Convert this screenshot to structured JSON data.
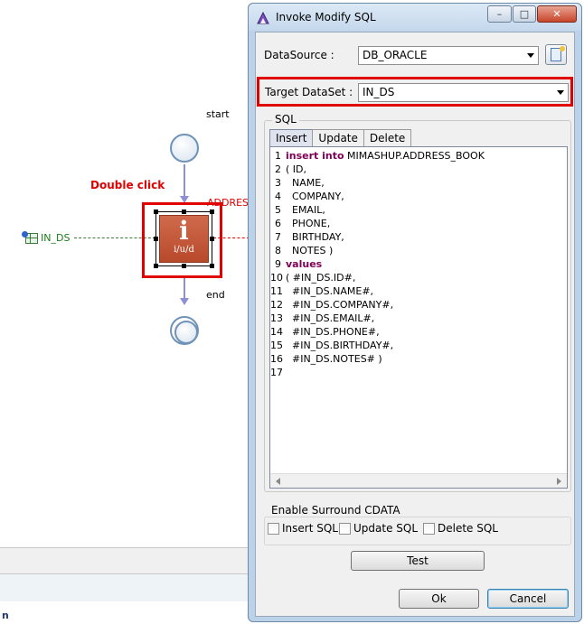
{
  "canvas": {
    "start_label": "start",
    "end_label": "end",
    "double_click_label": "Double click",
    "address_label": "ADDRESS",
    "task_glyph": "i",
    "task_sub": "i/u/d",
    "in_ds_label": "IN_DS",
    "bottom_letter": "n"
  },
  "dialog": {
    "title": "Invoke Modify SQL",
    "titlebar_buttons": {
      "minimize": "–",
      "maximize": "□",
      "close": "✕"
    },
    "datasource": {
      "label": "DataSource :",
      "value": "DB_ORACLE"
    },
    "target_dataset": {
      "label": "Target DataSet :",
      "value": "IN_DS"
    },
    "sql_group_label": "SQL",
    "tabs": [
      {
        "label": "Insert",
        "active": true
      },
      {
        "label": "Update",
        "active": false
      },
      {
        "label": "Delete",
        "active": false
      }
    ],
    "code_lines": [
      {
        "n": "1",
        "kw": "insert into",
        "text": " MIMASHUP.ADDRESS_BOOK"
      },
      {
        "n": "2",
        "kw": "",
        "text": "( ID,"
      },
      {
        "n": "3",
        "kw": "",
        "text": "  NAME,"
      },
      {
        "n": "4",
        "kw": "",
        "text": "  COMPANY,"
      },
      {
        "n": "5",
        "kw": "",
        "text": "  EMAIL,"
      },
      {
        "n": "6",
        "kw": "",
        "text": "  PHONE,"
      },
      {
        "n": "7",
        "kw": "",
        "text": "  BIRTHDAY,"
      },
      {
        "n": "8",
        "kw": "",
        "text": "  NOTES )"
      },
      {
        "n": "9",
        "kw": "values",
        "text": ""
      },
      {
        "n": "10",
        "kw": "",
        "text": "( #IN_DS.ID#,"
      },
      {
        "n": "11",
        "kw": "",
        "text": "  #IN_DS.NAME#,"
      },
      {
        "n": "12",
        "kw": "",
        "text": "  #IN_DS.COMPANY#,"
      },
      {
        "n": "13",
        "kw": "",
        "text": "  #IN_DS.EMAIL#,"
      },
      {
        "n": "14",
        "kw": "",
        "text": "  #IN_DS.PHONE#,"
      },
      {
        "n": "15",
        "kw": "",
        "text": "  #IN_DS.BIRTHDAY#,"
      },
      {
        "n": "16",
        "kw": "",
        "text": "  #IN_DS.NOTES# )"
      },
      {
        "n": "17",
        "kw": "",
        "text": ""
      }
    ],
    "cdata": {
      "label": "Enable Surround CDATA",
      "insert": "Insert SQL",
      "update": "Update SQL",
      "delete": "Delete SQL"
    },
    "buttons": {
      "test": "Test",
      "ok": "Ok",
      "cancel": "Cancel"
    }
  }
}
